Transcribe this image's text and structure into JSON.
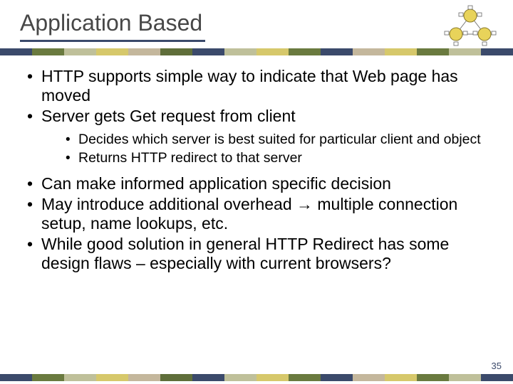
{
  "title": "Application Based",
  "bullets_a": [
    "HTTP supports simple way to indicate that Web page has moved",
    "Server gets Get request from client"
  ],
  "sub_bullets": [
    "Decides which server is best suited for particular client and object",
    "Returns HTTP redirect to that server"
  ],
  "bullets_b": [
    "Can make informed application specific decision",
    "May introduce additional overhead → multiple connection setup, name lookups, etc.",
    "While good solution in general HTTP Redirect has some design flaws – especially with current browsers?"
  ],
  "page_number": "35",
  "stripe_colors": [
    "#3b4a6b",
    "#6a7a3f",
    "#bfc09a",
    "#d6c86b",
    "#c4b79c",
    "#5f6e3a",
    "#3b4a6b",
    "#bfc09a",
    "#d6c86b",
    "#6a7a3f",
    "#3b4a6b",
    "#c4b79c",
    "#d6c86b",
    "#6a7a3f",
    "#bfc09a",
    "#3b4a6b"
  ]
}
